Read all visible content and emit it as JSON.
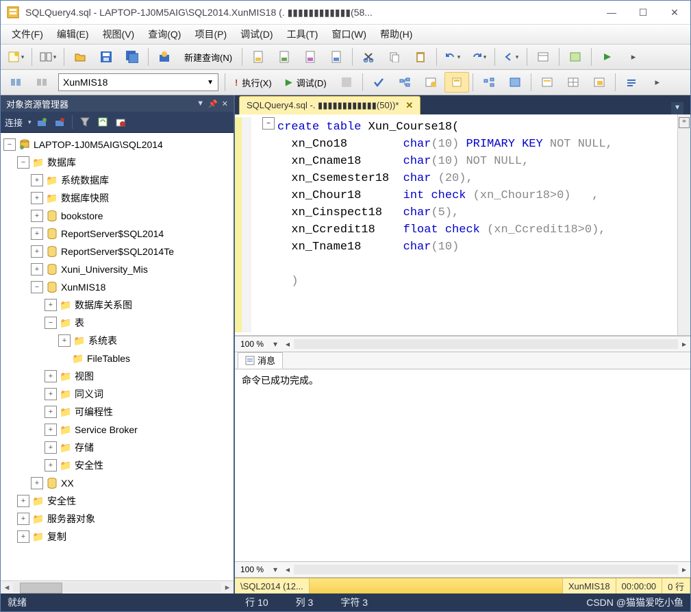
{
  "title": "SQLQuery4.sql - LAPTOP-1J0M5AIG\\SQL2014.XunMIS18 (. ▮▮▮▮▮▮▮▮▮▮▮▮(58...",
  "menu": [
    "文件(F)",
    "编辑(E)",
    "视图(V)",
    "查询(Q)",
    "项目(P)",
    "调试(D)",
    "工具(T)",
    "窗口(W)",
    "帮助(H)"
  ],
  "toolbar2": {
    "new_query": "新建查询(N)"
  },
  "toolbar3": {
    "db": "XunMIS18",
    "execute": "执行(X)",
    "debug": "调试(D)"
  },
  "left_panel": {
    "title": "对象资源管理器",
    "connect": "连接",
    "root": "LAPTOP-1J0M5AIG\\SQL2014",
    "nodes": {
      "databases": "数据库",
      "sysdb": "系统数据库",
      "snap": "数据库快照",
      "bookstore": "bookstore",
      "rs1": "ReportServer$SQL2014",
      "rs2": "ReportServer$SQL2014Te",
      "xuni": "Xuni_University_Mis",
      "xunmis": "XunMIS18",
      "diagram": "数据库关系图",
      "tables": "表",
      "systables": "系统表",
      "filetables": "FileTables",
      "views": "视图",
      "syn": "同义词",
      "prog": "可编程性",
      "sb": "Service Broker",
      "storage": "存储",
      "sec": "安全性",
      "xx": "XX",
      "sec2": "安全性",
      "srvobj": "服务器对象",
      "repl": "复制"
    }
  },
  "tab": {
    "label": "SQLQuery4.sql -. ▮▮▮▮▮▮▮▮▮▮▮▮(50))*"
  },
  "code": {
    "l1a": "create table",
    "l1b": " Xun_Course18(",
    "c1": "xn_Cno18",
    "t1": "char",
    "p1": "(10)",
    "k1": " PRIMARY KEY",
    "g1": " NOT NULL",
    "e1": ",",
    "c2": "xn_Cname18",
    "t2": "char",
    "p2": "(10)",
    "g2": " NOT NULL",
    "e2": ",",
    "c3": "xn_Csemester18",
    "t3": "char",
    "p3": " (20),",
    "c4": "xn_Chour18",
    "t4": "int check",
    "p4": " (xn_Chour18>0)   ,",
    "c5": "xn_Cinspect18",
    "t5": "char",
    "p5": "(5),",
    "c6": "xn_Ccredit18",
    "t6": "float check",
    "p6": " (xn_Ccredit18>0),",
    "c7": "xn_Tname18",
    "t7": "char",
    "p7": "(10)",
    "close": ")"
  },
  "zoom1": "100 %",
  "msg_tab": "消息",
  "msg_body": "命令已成功完成。",
  "zoom2": "100 %",
  "status_cells": {
    "conn": "\\SQL2014 (12...",
    "user": "",
    "db": "XunMIS18",
    "time": "00:00:00",
    "rows": "0 行"
  },
  "statusbar": {
    "ready": "就绪",
    "line": "行 10",
    "col": "列 3",
    "char": "字符 3",
    "csdn": "CSDN @猫猫爱吃小鱼"
  }
}
